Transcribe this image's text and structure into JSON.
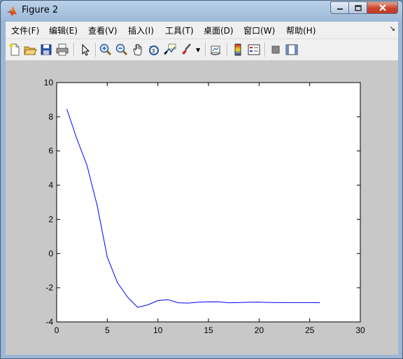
{
  "window": {
    "title": "Figure 2"
  },
  "menu": [
    "文件(F)",
    "编辑(E)",
    "查看(V)",
    "插入(I)",
    "工具(T)",
    "桌面(D)",
    "窗口(W)",
    "帮助(H)"
  ],
  "toolbar": [
    "new-figure",
    "open-file",
    "save-figure",
    "print-figure",
    "edit-plot",
    "zoom-in",
    "zoom-out",
    "pan",
    "rotate-3d",
    "data-cursor",
    "brush",
    "link-plot",
    "colorbar",
    "legend",
    "hide-plot-tools",
    "show-plot-tools"
  ],
  "chart_data": {
    "type": "line",
    "title": "",
    "xlabel": "",
    "ylabel": "",
    "xlim": [
      0,
      30
    ],
    "ylim": [
      -4,
      10
    ],
    "xticks": [
      0,
      5,
      10,
      15,
      20,
      25,
      30
    ],
    "yticks": [
      -4,
      -2,
      0,
      2,
      4,
      6,
      8,
      10
    ],
    "grid": false,
    "series": [
      {
        "color": "#0000ff",
        "x": [
          1,
          2,
          3,
          4,
          5,
          6,
          7,
          8,
          9,
          10,
          11,
          12,
          13,
          14,
          15,
          16,
          17,
          18,
          19,
          20,
          21,
          22,
          23,
          24,
          25,
          26
        ],
        "y": [
          8.45,
          6.7,
          5.15,
          2.8,
          -0.2,
          -1.7,
          -2.55,
          -3.15,
          -3.0,
          -2.75,
          -2.7,
          -2.88,
          -2.9,
          -2.85,
          -2.82,
          -2.83,
          -2.88,
          -2.87,
          -2.85,
          -2.84,
          -2.86,
          -2.87,
          -2.87,
          -2.87,
          -2.87,
          -2.88
        ]
      }
    ]
  }
}
